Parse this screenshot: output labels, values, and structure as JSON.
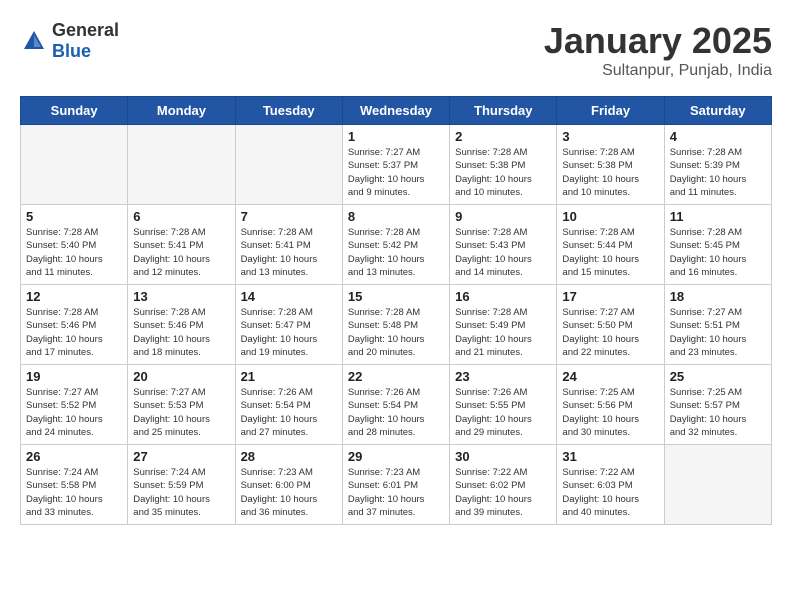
{
  "header": {
    "logo_general": "General",
    "logo_blue": "Blue",
    "title": "January 2025",
    "subtitle": "Sultanpur, Punjab, India"
  },
  "weekdays": [
    "Sunday",
    "Monday",
    "Tuesday",
    "Wednesday",
    "Thursday",
    "Friday",
    "Saturday"
  ],
  "weeks": [
    [
      {
        "num": "",
        "info": "",
        "empty": true
      },
      {
        "num": "",
        "info": "",
        "empty": true
      },
      {
        "num": "",
        "info": "",
        "empty": true
      },
      {
        "num": "1",
        "info": "Sunrise: 7:27 AM\nSunset: 5:37 PM\nDaylight: 10 hours\nand 9 minutes.",
        "empty": false
      },
      {
        "num": "2",
        "info": "Sunrise: 7:28 AM\nSunset: 5:38 PM\nDaylight: 10 hours\nand 10 minutes.",
        "empty": false
      },
      {
        "num": "3",
        "info": "Sunrise: 7:28 AM\nSunset: 5:38 PM\nDaylight: 10 hours\nand 10 minutes.",
        "empty": false
      },
      {
        "num": "4",
        "info": "Sunrise: 7:28 AM\nSunset: 5:39 PM\nDaylight: 10 hours\nand 11 minutes.",
        "empty": false
      }
    ],
    [
      {
        "num": "5",
        "info": "Sunrise: 7:28 AM\nSunset: 5:40 PM\nDaylight: 10 hours\nand 11 minutes.",
        "empty": false
      },
      {
        "num": "6",
        "info": "Sunrise: 7:28 AM\nSunset: 5:41 PM\nDaylight: 10 hours\nand 12 minutes.",
        "empty": false
      },
      {
        "num": "7",
        "info": "Sunrise: 7:28 AM\nSunset: 5:41 PM\nDaylight: 10 hours\nand 13 minutes.",
        "empty": false
      },
      {
        "num": "8",
        "info": "Sunrise: 7:28 AM\nSunset: 5:42 PM\nDaylight: 10 hours\nand 13 minutes.",
        "empty": false
      },
      {
        "num": "9",
        "info": "Sunrise: 7:28 AM\nSunset: 5:43 PM\nDaylight: 10 hours\nand 14 minutes.",
        "empty": false
      },
      {
        "num": "10",
        "info": "Sunrise: 7:28 AM\nSunset: 5:44 PM\nDaylight: 10 hours\nand 15 minutes.",
        "empty": false
      },
      {
        "num": "11",
        "info": "Sunrise: 7:28 AM\nSunset: 5:45 PM\nDaylight: 10 hours\nand 16 minutes.",
        "empty": false
      }
    ],
    [
      {
        "num": "12",
        "info": "Sunrise: 7:28 AM\nSunset: 5:46 PM\nDaylight: 10 hours\nand 17 minutes.",
        "empty": false
      },
      {
        "num": "13",
        "info": "Sunrise: 7:28 AM\nSunset: 5:46 PM\nDaylight: 10 hours\nand 18 minutes.",
        "empty": false
      },
      {
        "num": "14",
        "info": "Sunrise: 7:28 AM\nSunset: 5:47 PM\nDaylight: 10 hours\nand 19 minutes.",
        "empty": false
      },
      {
        "num": "15",
        "info": "Sunrise: 7:28 AM\nSunset: 5:48 PM\nDaylight: 10 hours\nand 20 minutes.",
        "empty": false
      },
      {
        "num": "16",
        "info": "Sunrise: 7:28 AM\nSunset: 5:49 PM\nDaylight: 10 hours\nand 21 minutes.",
        "empty": false
      },
      {
        "num": "17",
        "info": "Sunrise: 7:27 AM\nSunset: 5:50 PM\nDaylight: 10 hours\nand 22 minutes.",
        "empty": false
      },
      {
        "num": "18",
        "info": "Sunrise: 7:27 AM\nSunset: 5:51 PM\nDaylight: 10 hours\nand 23 minutes.",
        "empty": false
      }
    ],
    [
      {
        "num": "19",
        "info": "Sunrise: 7:27 AM\nSunset: 5:52 PM\nDaylight: 10 hours\nand 24 minutes.",
        "empty": false
      },
      {
        "num": "20",
        "info": "Sunrise: 7:27 AM\nSunset: 5:53 PM\nDaylight: 10 hours\nand 25 minutes.",
        "empty": false
      },
      {
        "num": "21",
        "info": "Sunrise: 7:26 AM\nSunset: 5:54 PM\nDaylight: 10 hours\nand 27 minutes.",
        "empty": false
      },
      {
        "num": "22",
        "info": "Sunrise: 7:26 AM\nSunset: 5:54 PM\nDaylight: 10 hours\nand 28 minutes.",
        "empty": false
      },
      {
        "num": "23",
        "info": "Sunrise: 7:26 AM\nSunset: 5:55 PM\nDaylight: 10 hours\nand 29 minutes.",
        "empty": false
      },
      {
        "num": "24",
        "info": "Sunrise: 7:25 AM\nSunset: 5:56 PM\nDaylight: 10 hours\nand 30 minutes.",
        "empty": false
      },
      {
        "num": "25",
        "info": "Sunrise: 7:25 AM\nSunset: 5:57 PM\nDaylight: 10 hours\nand 32 minutes.",
        "empty": false
      }
    ],
    [
      {
        "num": "26",
        "info": "Sunrise: 7:24 AM\nSunset: 5:58 PM\nDaylight: 10 hours\nand 33 minutes.",
        "empty": false
      },
      {
        "num": "27",
        "info": "Sunrise: 7:24 AM\nSunset: 5:59 PM\nDaylight: 10 hours\nand 35 minutes.",
        "empty": false
      },
      {
        "num": "28",
        "info": "Sunrise: 7:23 AM\nSunset: 6:00 PM\nDaylight: 10 hours\nand 36 minutes.",
        "empty": false
      },
      {
        "num": "29",
        "info": "Sunrise: 7:23 AM\nSunset: 6:01 PM\nDaylight: 10 hours\nand 37 minutes.",
        "empty": false
      },
      {
        "num": "30",
        "info": "Sunrise: 7:22 AM\nSunset: 6:02 PM\nDaylight: 10 hours\nand 39 minutes.",
        "empty": false
      },
      {
        "num": "31",
        "info": "Sunrise: 7:22 AM\nSunset: 6:03 PM\nDaylight: 10 hours\nand 40 minutes.",
        "empty": false
      },
      {
        "num": "",
        "info": "",
        "empty": true
      }
    ]
  ]
}
